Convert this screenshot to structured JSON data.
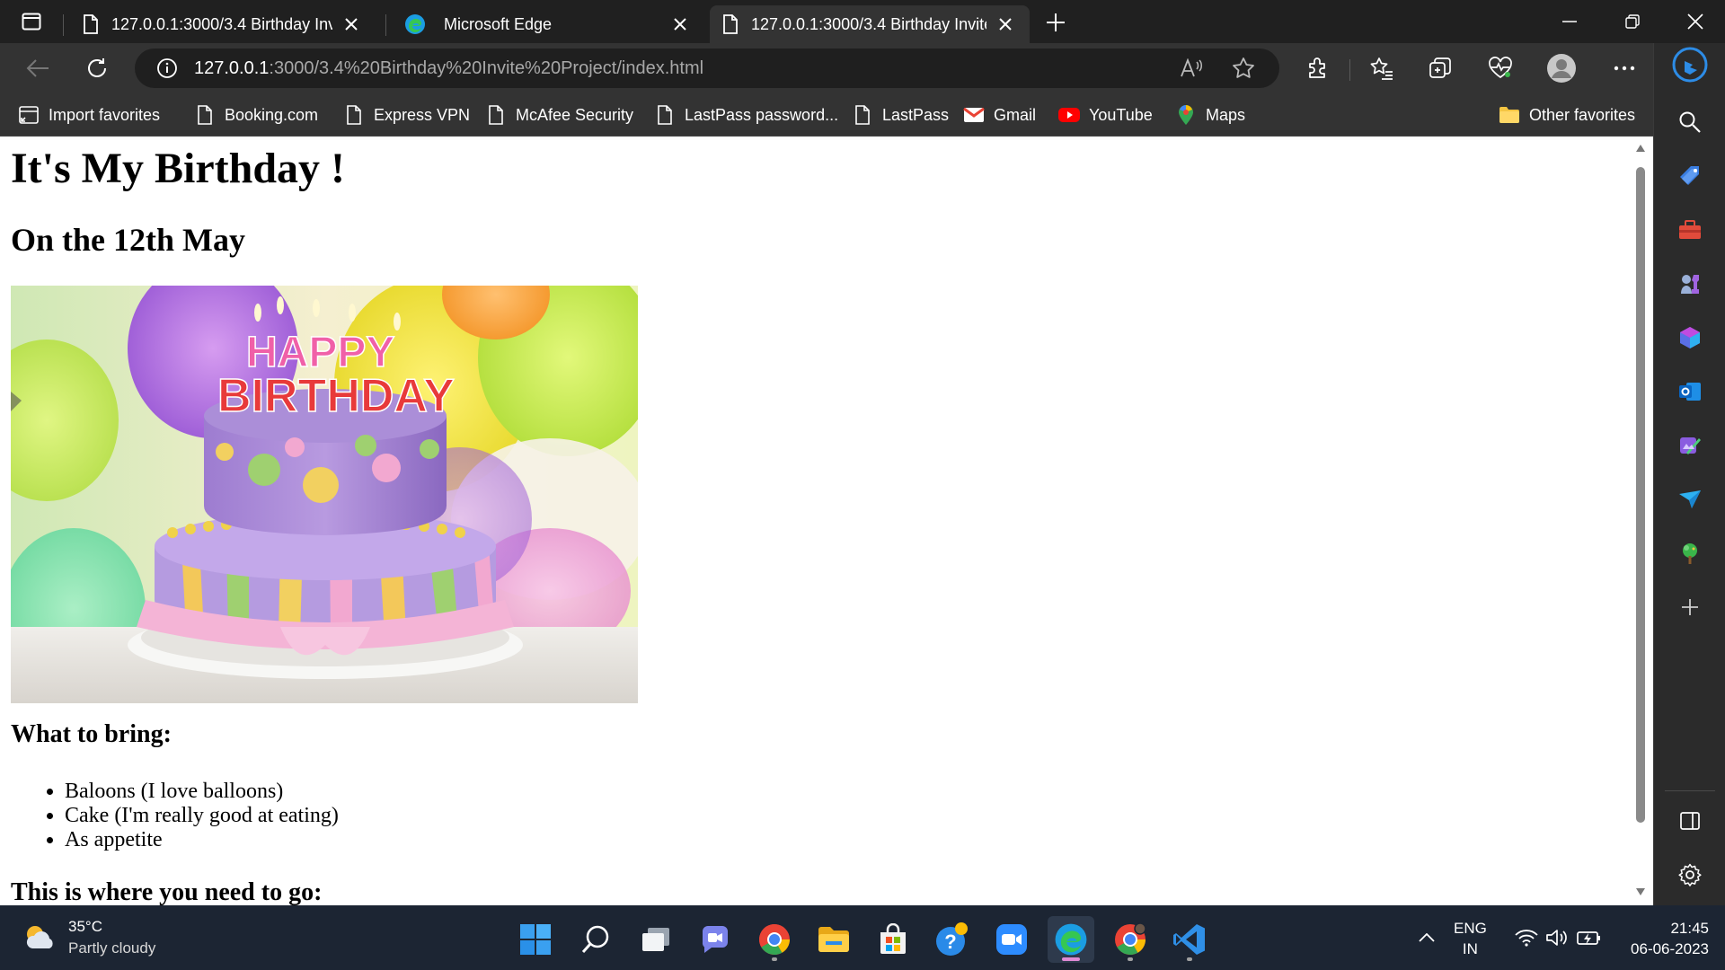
{
  "tabs": [
    {
      "title": "127.0.0.1:3000/3.4 Birthday Invite",
      "active": false
    },
    {
      "title": "Microsoft Edge",
      "active": false
    },
    {
      "title": "127.0.0.1:3000/3.4 Birthday Invite",
      "active": true
    }
  ],
  "address": {
    "host": "127.0.0.1",
    "path": ":3000/3.4%20Birthday%20Invite%20Project/index.html"
  },
  "favorites": [
    {
      "label": "Import favorites",
      "icon": "import-icon"
    },
    {
      "label": "Booking.com",
      "icon": "page-icon"
    },
    {
      "label": "Express VPN",
      "icon": "page-icon"
    },
    {
      "label": "McAfee Security",
      "icon": "page-icon"
    },
    {
      "label": "LastPass password...",
      "icon": "page-icon"
    },
    {
      "label": "LastPass",
      "icon": "page-icon"
    },
    {
      "label": "Gmail",
      "icon": "gmail-icon"
    },
    {
      "label": "YouTube",
      "icon": "youtube-icon"
    },
    {
      "label": "Maps",
      "icon": "maps-icon"
    }
  ],
  "other_favorites": "Other favorites",
  "cake_image_text": {
    "line1": "HAPPY",
    "line2": "BIRTHDAY"
  },
  "page": {
    "heading": "It's My Birthday !",
    "subheading": "On the 12th May",
    "bring_heading": "What to bring:",
    "bring_items": [
      "Baloons (I love balloons)",
      "Cake (I'm really good at eating)",
      "As appetite"
    ],
    "go_heading": "This is where you need to go:"
  },
  "taskbar": {
    "weather_temp": "35°C",
    "weather_desc": "Partly cloudy",
    "lang_1": "ENG",
    "lang_2": "IN",
    "time": "21:45",
    "date": "06-06-2023"
  },
  "colors": {
    "edge_blue": "#0f78d4",
    "vscode_blue": "#2f8fe6",
    "chrome_red": "#ea4335",
    "chrome_yellow": "#fbbc05",
    "chrome_green": "#34a853"
  }
}
